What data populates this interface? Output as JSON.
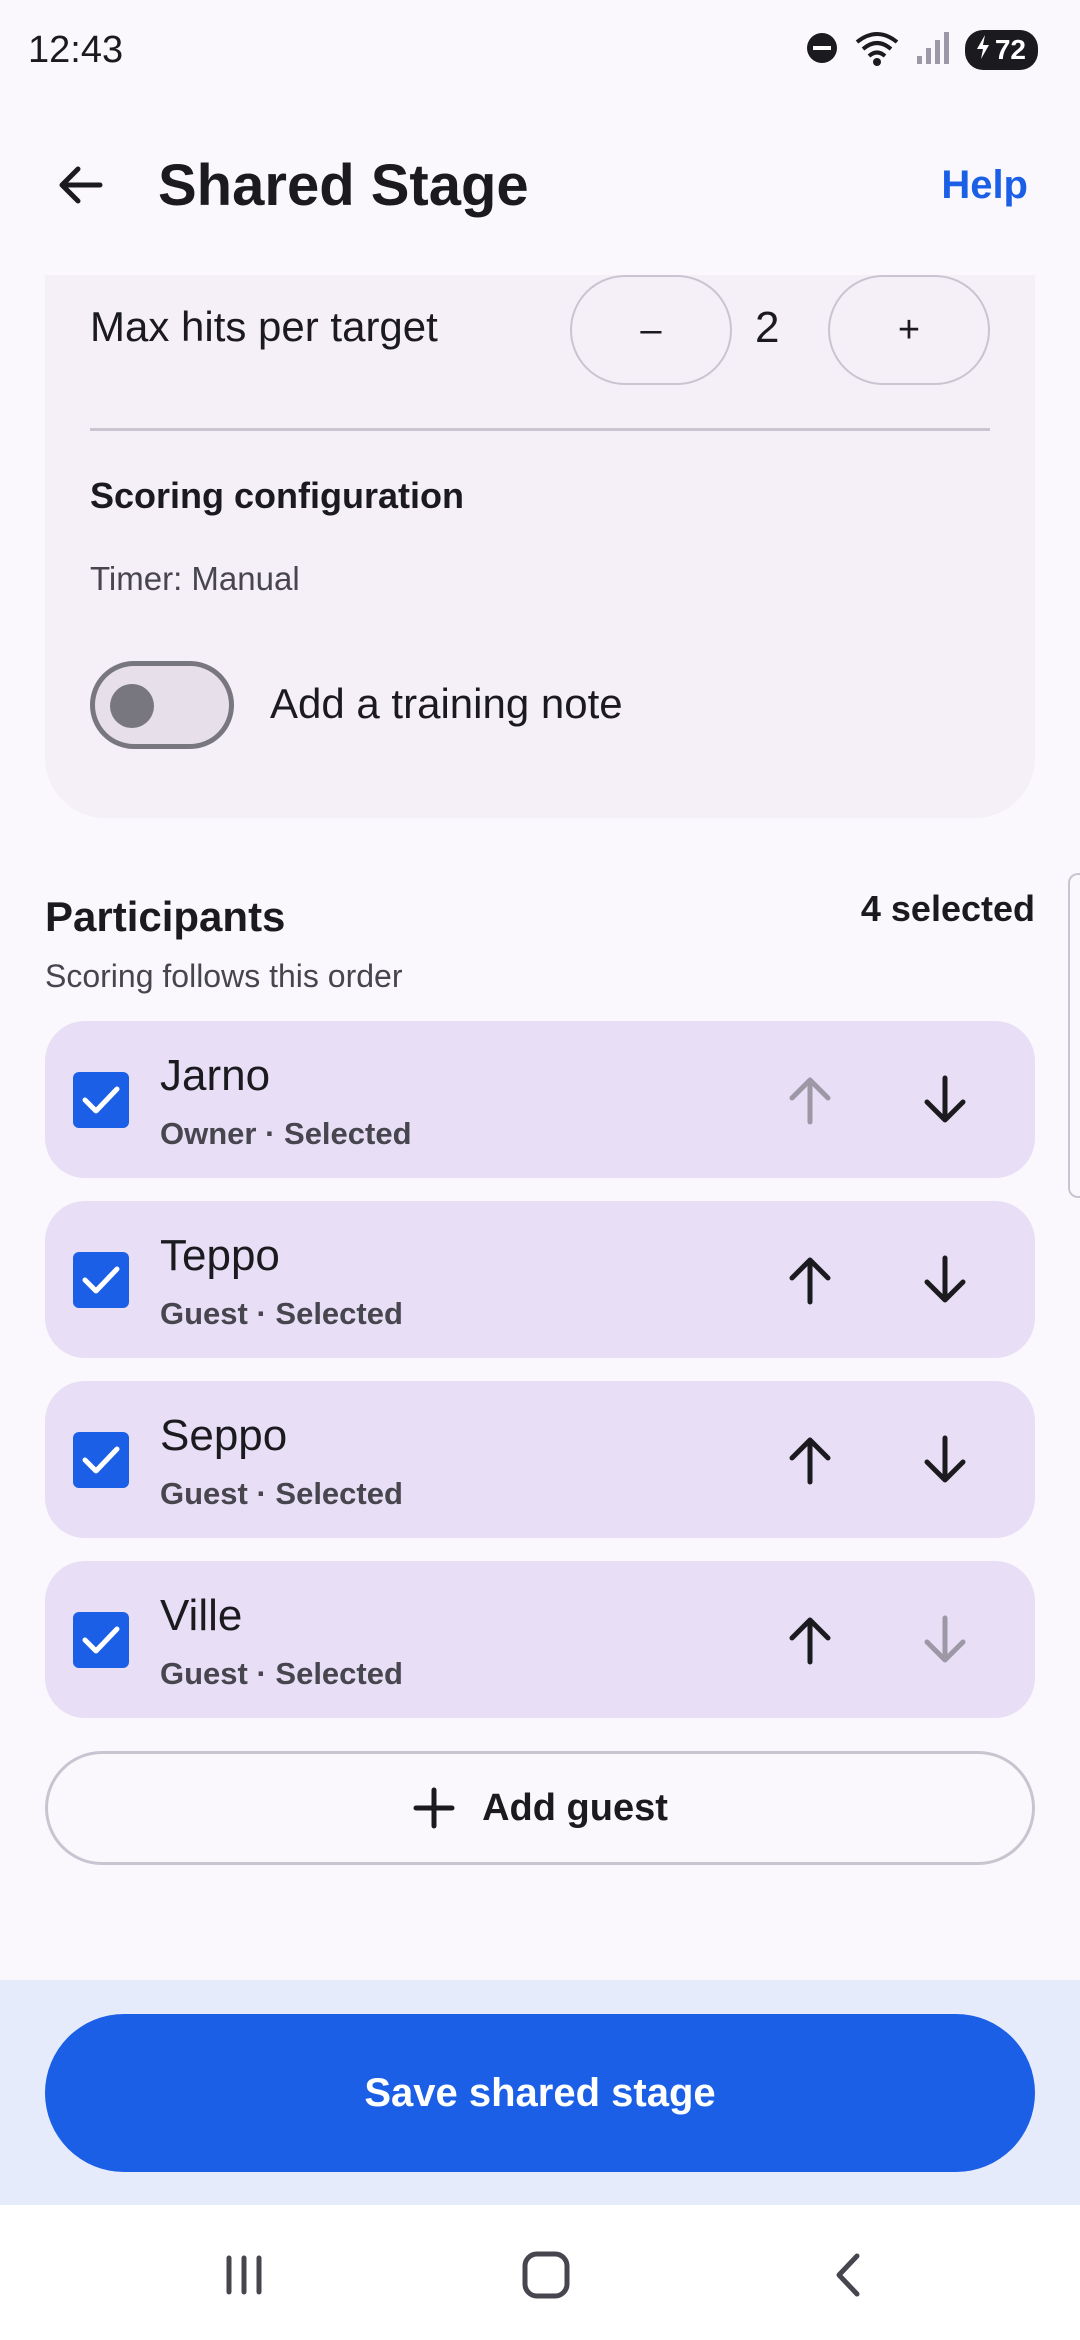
{
  "status": {
    "time": "12:43",
    "battery": "72",
    "icons": [
      "do-not-disturb-icon",
      "wifi-icon",
      "signal-icon",
      "battery-charging-icon"
    ]
  },
  "header": {
    "title": "Shared Stage",
    "help": "Help"
  },
  "settings": {
    "max_hits_label": "Max hits per target",
    "max_hits_value": "2",
    "minus": "–",
    "plus": "+",
    "scoring_title": "Scoring configuration",
    "timer": "Timer: Manual",
    "training_note_label": "Add a training note",
    "training_note_enabled": false
  },
  "participants": {
    "title": "Participants",
    "selected": "4 selected",
    "subtitle": "Scoring follows this order",
    "items": [
      {
        "name": "Jarno",
        "role": "Owner · Selected",
        "checked": true,
        "up_enabled": false,
        "down_enabled": true
      },
      {
        "name": "Teppo",
        "role": "Guest · Selected",
        "checked": true,
        "up_enabled": true,
        "down_enabled": true
      },
      {
        "name": "Seppo",
        "role": "Guest · Selected",
        "checked": true,
        "up_enabled": true,
        "down_enabled": true
      },
      {
        "name": "Ville",
        "role": "Guest · Selected",
        "checked": true,
        "up_enabled": true,
        "down_enabled": false
      }
    ],
    "add_guest": "Add guest"
  },
  "footer": {
    "save": "Save shared stage"
  },
  "colors": {
    "accent": "#1a5fe6",
    "card": "#f5eff7",
    "participant": "#e8def6"
  }
}
